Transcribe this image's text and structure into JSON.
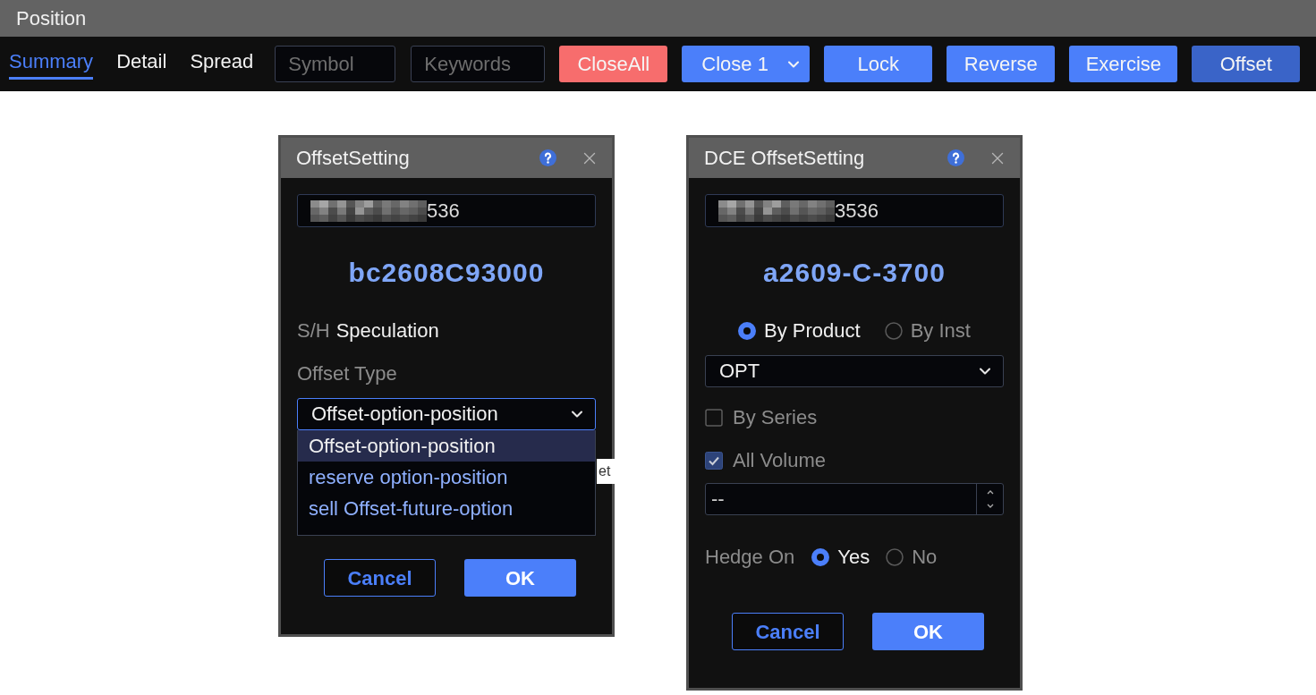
{
  "window": {
    "title": "Position"
  },
  "tabs": [
    {
      "label": "Summary",
      "selected": true
    },
    {
      "label": "Detail",
      "selected": false
    },
    {
      "label": "Spread",
      "selected": false
    }
  ],
  "search_fields": [
    {
      "placeholder": "Symbol"
    },
    {
      "placeholder": "Keywords"
    }
  ],
  "toolbar_buttons": [
    {
      "label": "CloseAll",
      "kind": "danger"
    },
    {
      "label": "Close 1",
      "kind": "split"
    },
    {
      "label": "Lock",
      "kind": "primary"
    },
    {
      "label": "Reverse",
      "kind": "primary"
    },
    {
      "label": "Exercise",
      "kind": "primary"
    },
    {
      "label": "Offset",
      "kind": "pressed"
    }
  ],
  "dialogs": [
    {
      "title": "OffsetSetting",
      "account": "536",
      "symbol": "bc2608C93000",
      "fields": [
        {
          "kind": "info",
          "label": "S/H",
          "value": "Speculation"
        },
        {
          "kind": "label",
          "label": "Offset Type"
        },
        {
          "kind": "select",
          "value": "Offset-option-position",
          "expanded": true,
          "options": [
            {
              "label": "Offset-option-position",
              "selected": true
            },
            {
              "label": "reserve option-position",
              "selected": false
            },
            {
              "label": "sell Offset-future-option",
              "selected": false
            }
          ]
        }
      ],
      "tooltip": "et",
      "buttons": [
        {
          "label": "Cancel",
          "kind": "secondary"
        },
        {
          "label": "OK",
          "kind": "primary"
        }
      ]
    },
    {
      "title": "DCE OffsetSetting",
      "account": "3536",
      "symbol": "a2609-C-3700",
      "fields": [
        {
          "kind": "radio_group",
          "options": [
            {
              "label": "By Product",
              "selected": true
            },
            {
              "label": "By Inst",
              "selected": false
            }
          ]
        },
        {
          "kind": "select",
          "value": "OPT",
          "expanded": false
        },
        {
          "kind": "checkbox",
          "label": "By Series",
          "checked": false
        },
        {
          "kind": "checkbox",
          "label": "All Volume",
          "checked": true
        },
        {
          "kind": "spin",
          "value": "--"
        },
        {
          "kind": "radio_group",
          "label": "Hedge On",
          "options": [
            {
              "label": "Yes",
              "selected": true
            },
            {
              "label": "No",
              "selected": false
            }
          ]
        }
      ],
      "buttons": [
        {
          "label": "Cancel",
          "kind": "secondary"
        },
        {
          "label": "OK",
          "kind": "primary"
        }
      ]
    }
  ]
}
